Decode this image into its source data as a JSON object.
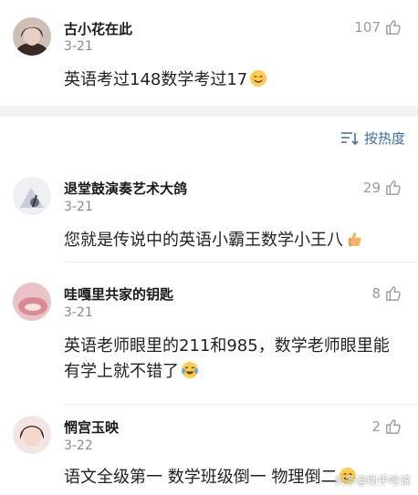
{
  "comments": [
    {
      "username": "古小花在此",
      "date": "3-21",
      "likes": "107",
      "text": "英语考过148数学考过17",
      "emoji": "smiling-face-emoji"
    },
    {
      "username": "退堂鼓演奏艺术大鸽",
      "date": "3-21",
      "likes": "29",
      "text": "您就是传说中的英语小霸王数学小王八",
      "emoji": "thumbs-up-emoji"
    },
    {
      "username": "哇嘎里共家的钥匙",
      "date": "3-21",
      "likes": "8",
      "text": "英语老师眼里的211和985，数学老师眼里能有学上就不错了",
      "emoji": "crying-laughing-emoji"
    },
    {
      "username": "惘宫玉映",
      "date": "3-22",
      "likes": "2",
      "text": "语文全级第一 数学班级倒一 物理倒二",
      "emoji": "smiling-face-emoji"
    }
  ],
  "sort": {
    "label": "按热度",
    "icon": "sort-icon"
  },
  "watermark": {
    "text": "头条@助手哈说"
  },
  "icons": {
    "like": "thumbs-up-outline-icon"
  },
  "colors": {
    "accent": "#3d6fa8",
    "muted": "#9a9a9a",
    "band": "#f2f2f2"
  }
}
